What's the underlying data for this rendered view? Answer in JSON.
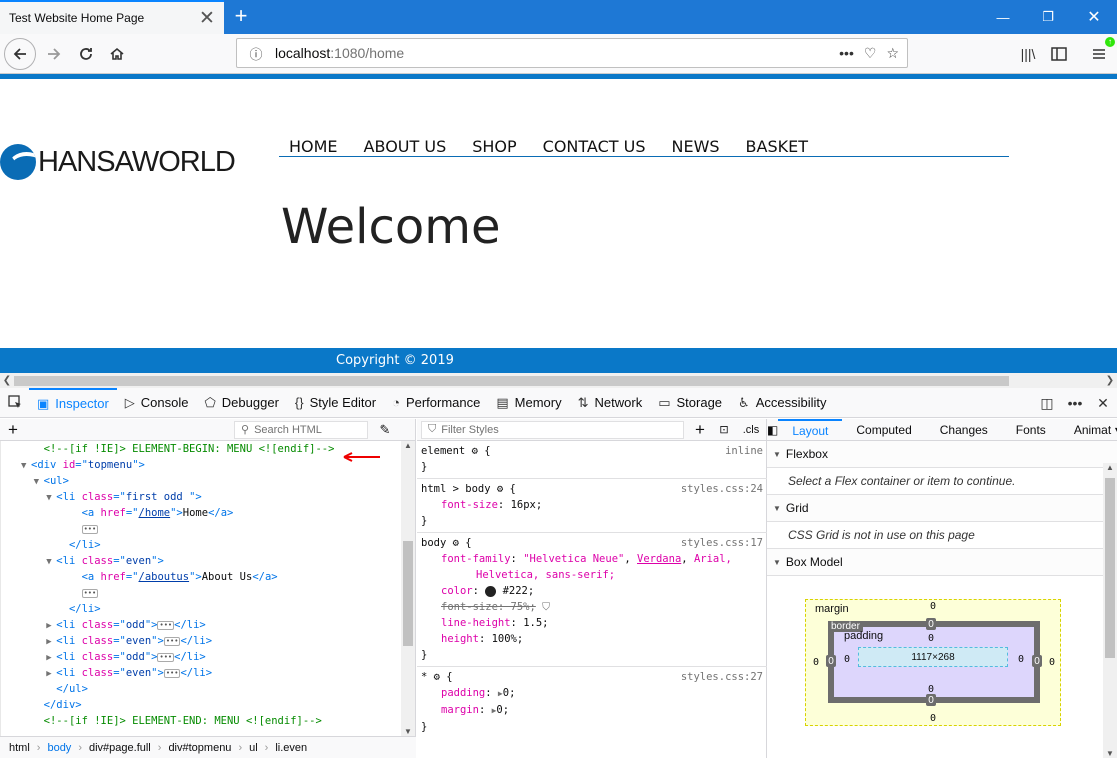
{
  "browser": {
    "tab_title": "Test Website Home Page",
    "url_host": "localhost",
    "url_rest": ":1080/home"
  },
  "site": {
    "logo_text": "HANSAWORLD",
    "menu": [
      "HOME",
      "ABOUT US",
      "SHOP",
      "CONTACT US",
      "NEWS",
      "BASKET"
    ],
    "heading": "Welcome",
    "footer": "Copyright © 2019"
  },
  "devtools": {
    "tabs": [
      "Inspector",
      "Console",
      "Debugger",
      "Style Editor",
      "Performance",
      "Memory",
      "Network",
      "Storage",
      "Accessibility"
    ],
    "search_html_placeholder": "Search HTML",
    "filter_styles_placeholder": "Filter Styles",
    "cls_label": ".cls",
    "markup_lines": [
      {
        "indent": 1,
        "kind": "comment",
        "text": "<!--[if !IE]> ELEMENT-BEGIN: MENU <![endif]-->"
      },
      {
        "indent": 0,
        "twisty": "▼",
        "open": "div",
        "attr": "id",
        "val": "topmenu"
      },
      {
        "indent": 1,
        "twisty": "▼",
        "open": "ul"
      },
      {
        "indent": 2,
        "twisty": "▼",
        "open": "li",
        "attr": "class",
        "val": "first odd "
      },
      {
        "indent": 4,
        "kind": "anchor",
        "href": "/home",
        "label": "Home"
      },
      {
        "indent": 4,
        "kind": "ellipsis"
      },
      {
        "indent": 3,
        "close": "li"
      },
      {
        "indent": 2,
        "twisty": "▼",
        "open": "li",
        "attr": "class",
        "val": "even"
      },
      {
        "indent": 4,
        "kind": "anchor",
        "href": "/aboutus",
        "label": "About Us"
      },
      {
        "indent": 4,
        "kind": "ellipsis"
      },
      {
        "indent": 3,
        "close": "li"
      },
      {
        "indent": 2,
        "twisty": "▶",
        "collapsed": true,
        "attr": "class",
        "val": "odd"
      },
      {
        "indent": 2,
        "twisty": "▶",
        "collapsed": true,
        "attr": "class",
        "val": "even"
      },
      {
        "indent": 2,
        "twisty": "▶",
        "collapsed": true,
        "attr": "class",
        "val": "odd"
      },
      {
        "indent": 2,
        "twisty": "▶",
        "collapsed": true,
        "attr": "class",
        "val": "even"
      },
      {
        "indent": 2,
        "close": "ul"
      },
      {
        "indent": 1,
        "close": "div"
      },
      {
        "indent": 1,
        "kind": "comment",
        "text": "<!--[if !IE]> ELEMENT-END: MENU <![endif]-->"
      }
    ],
    "breadcrumbs": [
      "html",
      "body",
      "div#page.full",
      "div#topmenu",
      "ul",
      "li.even"
    ],
    "rules": {
      "element": {
        "selector": "element",
        "source": "inline"
      },
      "html_body": {
        "selector": "html > body",
        "source": "styles.css:24",
        "decls": [
          {
            "prop": "font-size",
            "value": "16px"
          }
        ]
      },
      "body": {
        "selector": "body",
        "source": "styles.css:17",
        "font_family_prop": "font-family",
        "font_family_parts": [
          "\"Helvetica Neue\"",
          "Verdana",
          "Arial,",
          "Helvetica",
          ", sans-serif;"
        ],
        "color_prop": "color",
        "color_value": "#222",
        "font_size_overridden": "font-size: 75%;",
        "line_height_prop": "line-height",
        "line_height_value": "1.5",
        "height_prop": "height",
        "height_value": "100%"
      },
      "universal": {
        "selector": "*",
        "source": "styles.css:27",
        "padding_prop": "padding",
        "padding_value": "0",
        "margin_prop": "margin",
        "margin_value": "0"
      }
    },
    "layout_tabs": [
      "Layout",
      "Computed",
      "Changes",
      "Fonts",
      "Animat"
    ],
    "sections": {
      "flexbox": "Flexbox",
      "flexbox_msg": "Select a Flex container or item to continue.",
      "grid": "Grid",
      "grid_msg": "CSS Grid is not in use on this page",
      "boxmodel": "Box Model"
    },
    "box_model": {
      "margin_label": "margin",
      "border_label": "border",
      "padding_label": "padding",
      "content": "1117×268",
      "margin_top": "0",
      "margin_right": "0",
      "margin_bottom": "0",
      "margin_left": "0",
      "border_top": "0",
      "border_right": "0",
      "border_bottom": "0",
      "border_left": "0",
      "padding_top": "0",
      "padding_right": "0",
      "padding_bottom": "0",
      "padding_left": "0"
    }
  }
}
